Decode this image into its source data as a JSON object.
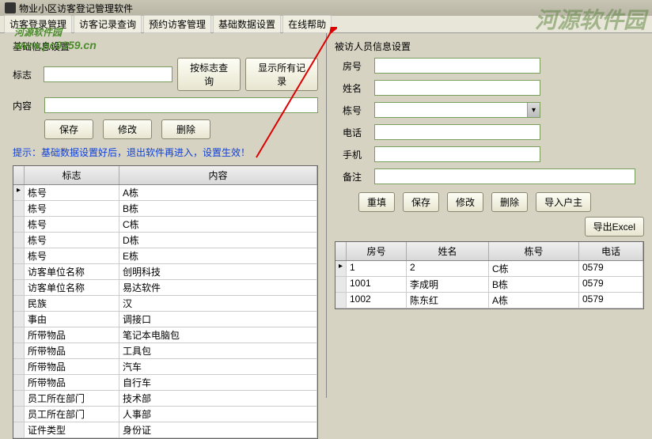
{
  "titlebar": {
    "title": "物业小区访客登记管理软件"
  },
  "menu": {
    "items": [
      "访客登录管理",
      "访客记录查询",
      "预约访客管理",
      "基础数据设置",
      "在线帮助"
    ]
  },
  "watermark": {
    "line1": "河源软件园",
    "line2": "www.pc0359.cn"
  },
  "left": {
    "group_title": "基础信息设置",
    "flag_label": "标志",
    "content_label": "内容",
    "search_btn": "按标志查询",
    "showall_btn": "显示所有记录",
    "save_btn": "保存",
    "modify_btn": "修改",
    "delete_btn": "删除",
    "hint": "提示：基础数据设置好后，退出软件再进入，设置生效！",
    "grid_headers": [
      "标志",
      "内容"
    ],
    "grid_rows": [
      [
        "栋号",
        "A栋"
      ],
      [
        "栋号",
        "B栋"
      ],
      [
        "栋号",
        "C栋"
      ],
      [
        "栋号",
        "D栋"
      ],
      [
        "栋号",
        "E栋"
      ],
      [
        "访客单位名称",
        "创明科技"
      ],
      [
        "访客单位名称",
        "易达软件"
      ],
      [
        "民族",
        "汉"
      ],
      [
        "事由",
        "调接口"
      ],
      [
        "所带物品",
        "笔记本电脑包"
      ],
      [
        "所带物品",
        "工具包"
      ],
      [
        "所带物品",
        "汽车"
      ],
      [
        "所带物品",
        "自行车"
      ],
      [
        "员工所在部门",
        "技术部"
      ],
      [
        "员工所在部门",
        "人事部"
      ],
      [
        "证件类型",
        "身份证"
      ]
    ]
  },
  "right": {
    "group_title": "被访人员信息设置",
    "room_label": "房号",
    "name_label": "姓名",
    "building_label": "栋号",
    "phone_label": "电话",
    "mobile_label": "手机",
    "remark_label": "备注",
    "reset_btn": "重填",
    "save_btn": "保存",
    "modify_btn": "修改",
    "delete_btn": "删除",
    "import_btn": "导入户主",
    "export_btn": "导出Excel",
    "grid_headers": [
      "房号",
      "姓名",
      "栋号",
      "电话"
    ],
    "grid_rows": [
      [
        "1",
        "2",
        "C栋",
        "0579"
      ],
      [
        "1001",
        "李成明",
        "B栋",
        "0579"
      ],
      [
        "1002",
        "陈东红",
        "A栋",
        "0579"
      ]
    ]
  }
}
